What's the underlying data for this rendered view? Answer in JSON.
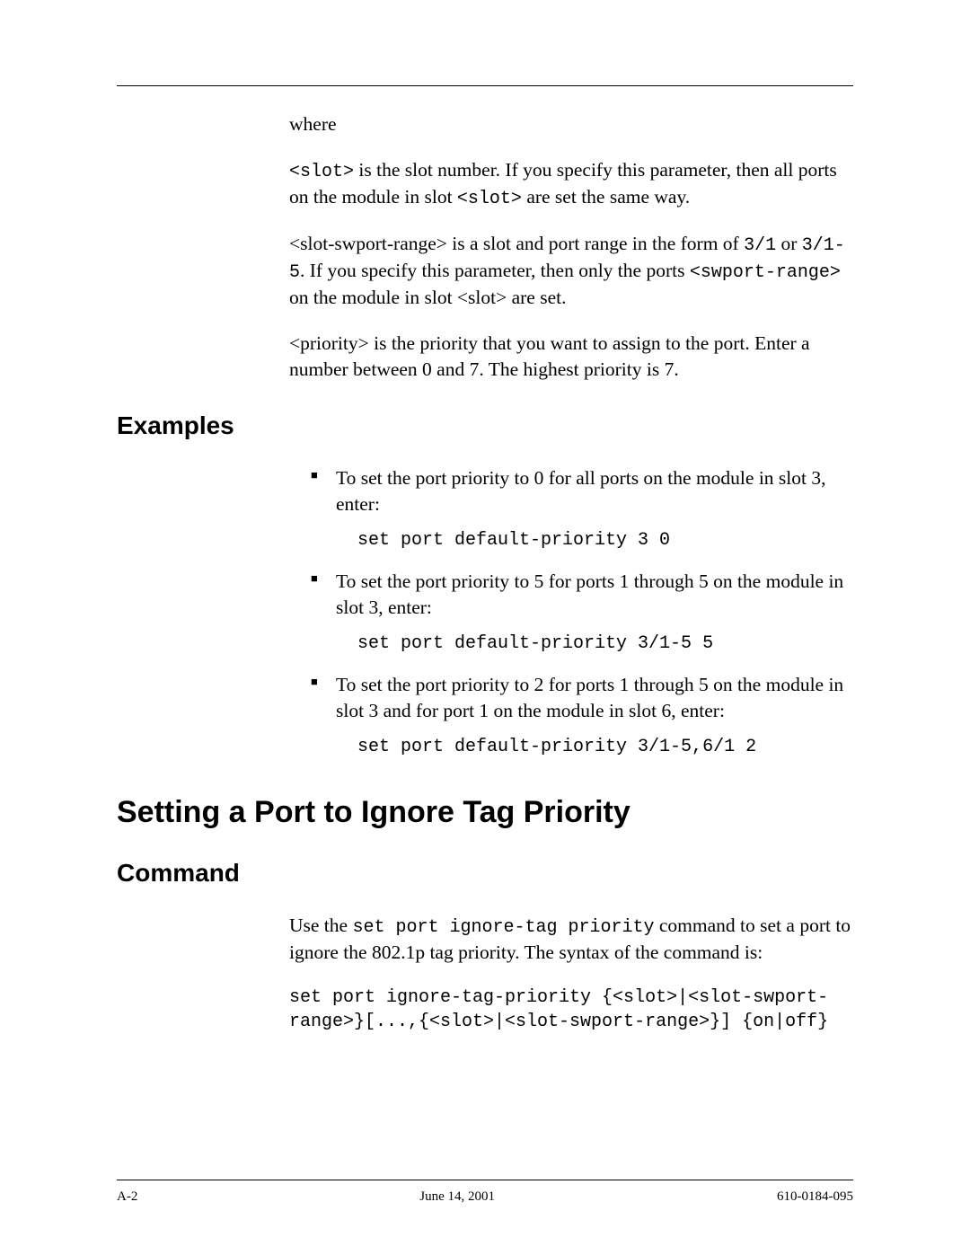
{
  "intro": {
    "where": "where",
    "p1_a": "<slot>",
    "p1_b": " is the slot number. If you specify this parameter, then all ports on the module in slot ",
    "p1_c": "<slot>",
    "p1_d": " are set the same way.",
    "p2_a": "<slot-swport-range> is a slot and port range in the form of ",
    "p2_b": "3/1",
    "p2_c": " or ",
    "p2_d": "3/1-5",
    "p2_e": ". If you specify this parameter, then only the ports ",
    "p2_f": "<swport-range>",
    "p2_g": " on the module in slot <slot> are set.",
    "p3": "<priority> is the priority that you want to assign to the port. Enter a number between 0 and 7. The highest priority is 7."
  },
  "examplesHead": "Examples",
  "examples": [
    {
      "text": "To set the port priority to 0 for all ports on the module in slot 3, enter:",
      "cmd": "set port default-priority 3 0"
    },
    {
      "text": "To set the port priority to 5 for ports 1 through 5 on the module in slot 3, enter:",
      "cmd": "set port default-priority 3/1-5 5"
    },
    {
      "text": "To set the port priority to 2 for ports 1 through 5 on the module in slot 3 and for port 1 on the module in slot 6, enter:",
      "cmd": "set port default-priority 3/1-5,6/1 2"
    }
  ],
  "h1": "Setting a Port to Ignore Tag Priority",
  "commandHead": "Command",
  "command": {
    "p_a": "Use the ",
    "p_b": "set port ignore-tag priority",
    "p_c": " command to set a port to ignore the 802.1p tag priority. The syntax of the command is:",
    "syntax": "set port ignore-tag-priority {<slot>|<slot-swport-\nrange>}[...,{<slot>|<slot-swport-range>}] {on|off}"
  },
  "footer": {
    "left": "A-2",
    "center": "June 14, 2001",
    "right": "610-0184-095"
  }
}
